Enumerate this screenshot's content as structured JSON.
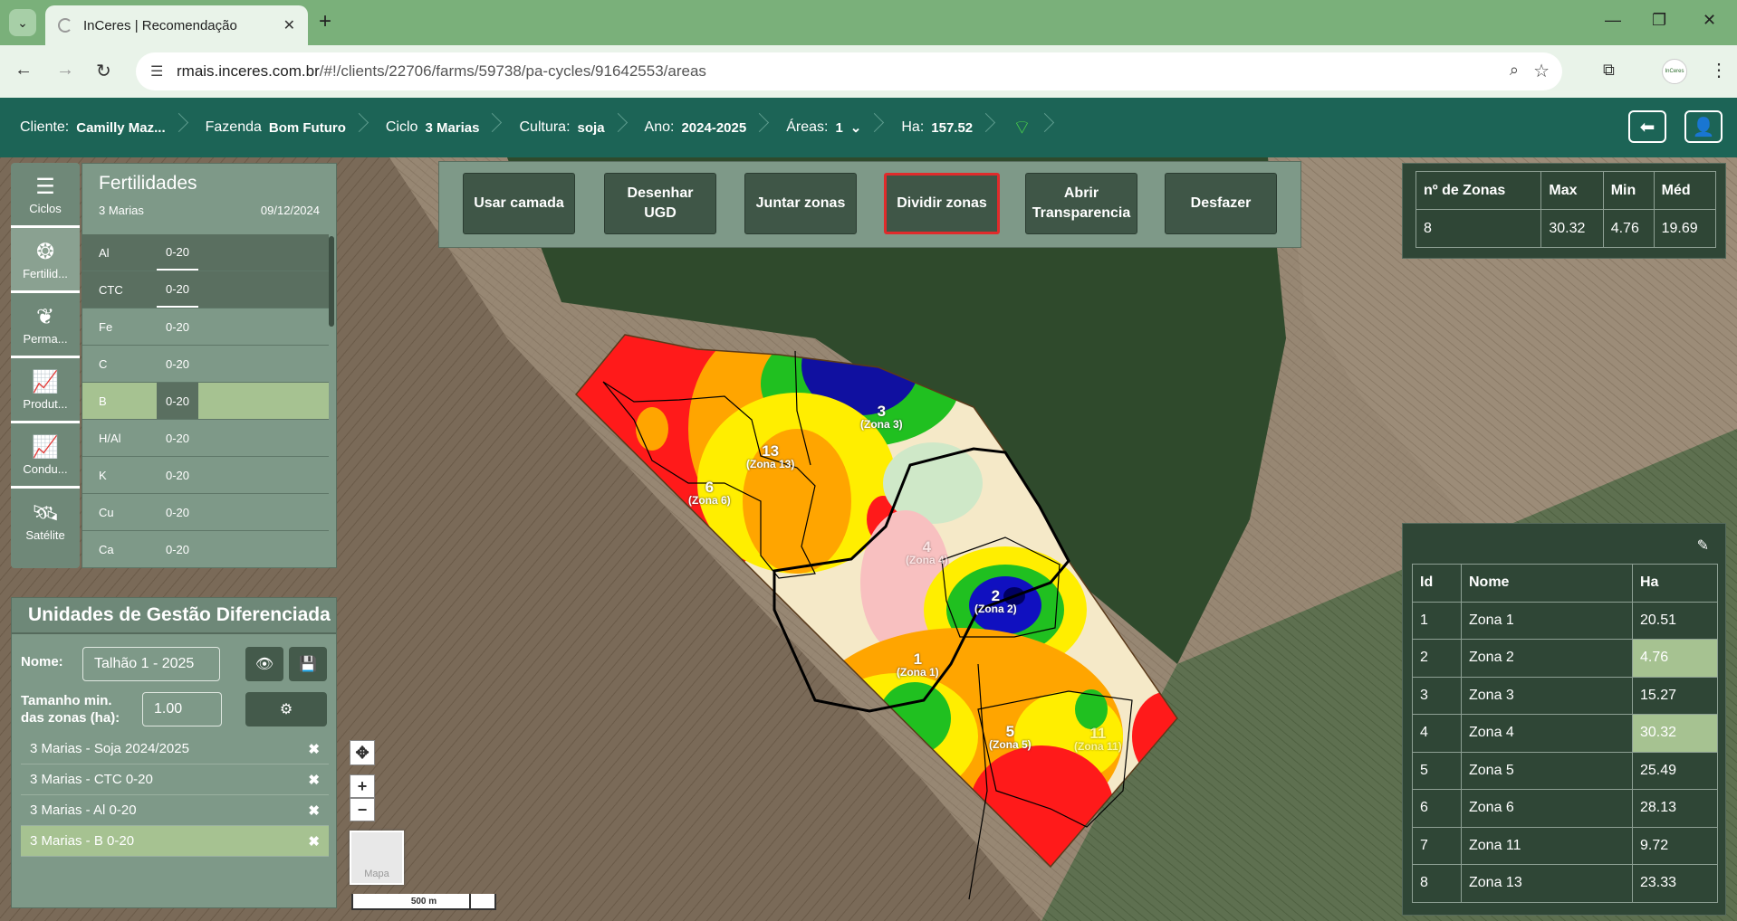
{
  "browser": {
    "tab_title": "InCeres | Recomendação",
    "url_host": "rmais.inceres.com.br",
    "url_path": "/#!/clients/22706/farms/59738/pa-cycles/91642553/areas",
    "profile_label": "InCeres"
  },
  "header": {
    "cliente_label": "Cliente:",
    "cliente_value": "Camilly Maz...",
    "fazenda_label": "Fazenda",
    "fazenda_value": "Bom Futuro",
    "ciclo_label": "Ciclo",
    "ciclo_value": "3 Marias",
    "cultura_label": "Cultura:",
    "cultura_value": "soja",
    "ano_label": "Ano:",
    "ano_value": "2024-2025",
    "areas_label": "Áreas:",
    "areas_value": "1",
    "ha_label": "Ha:",
    "ha_value": "157.52"
  },
  "sidebar": {
    "items": [
      {
        "label": "Ciclos",
        "icon": "list-icon"
      },
      {
        "label": "Fertilid...",
        "icon": "fertility-icon"
      },
      {
        "label": "Perma...",
        "icon": "plants-icon"
      },
      {
        "label": "Produt...",
        "icon": "chart-icon"
      },
      {
        "label": "Condu...",
        "icon": "chart-icon"
      },
      {
        "label": "Satélite",
        "icon": "satellite-icon"
      }
    ]
  },
  "fertilidades": {
    "title": "Fertilidades",
    "subtitle": "3 Marias",
    "date": "09/12/2024",
    "rows": [
      {
        "name": "Al",
        "depth": "0-20"
      },
      {
        "name": "CTC",
        "depth": "0-20"
      },
      {
        "name": "Fe",
        "depth": "0-20"
      },
      {
        "name": "C",
        "depth": "0-20"
      },
      {
        "name": "B",
        "depth": "0-20"
      },
      {
        "name": "H/Al",
        "depth": "0-20"
      },
      {
        "name": "K",
        "depth": "0-20"
      },
      {
        "name": "Cu",
        "depth": "0-20"
      },
      {
        "name": "Ca",
        "depth": "0-20"
      }
    ]
  },
  "ugd": {
    "title": "Unidades de Gestão Diferenciada",
    "nome_label": "Nome:",
    "nome_value": "Talhão 1 - 2025",
    "tamanho_label_1": "Tamanho min.",
    "tamanho_label_2": "das zonas (ha):",
    "tamanho_value": "1.00",
    "layers": [
      {
        "label": "3 Marias - Soja 2024/2025"
      },
      {
        "label": "3 Marias - CTC 0-20"
      },
      {
        "label": "3 Marias - Al 0-20"
      },
      {
        "label": "3 Marias - B 0-20"
      }
    ]
  },
  "toolbar": {
    "usar_camada": "Usar camada",
    "desenhar_1": "Desenhar",
    "desenhar_2": "UGD",
    "juntar": "Juntar zonas",
    "dividir": "Dividir zonas",
    "abrir_1": "Abrir",
    "abrir_2": "Transparencia",
    "desfazer": "Desfazer"
  },
  "stats": {
    "headers": [
      "nº de Zonas",
      "Max",
      "Min",
      "Méd"
    ],
    "values": [
      "8",
      "30.32",
      "4.76",
      "19.69"
    ]
  },
  "zones_table": {
    "headers": [
      "Id",
      "Nome",
      "Ha"
    ],
    "rows": [
      {
        "id": "1",
        "nome": "Zona 1",
        "ha": "20.51"
      },
      {
        "id": "2",
        "nome": "Zona 2",
        "ha": "4.76"
      },
      {
        "id": "3",
        "nome": "Zona 3",
        "ha": "15.27"
      },
      {
        "id": "4",
        "nome": "Zona 4",
        "ha": "30.32"
      },
      {
        "id": "5",
        "nome": "Zona 5",
        "ha": "25.49"
      },
      {
        "id": "6",
        "nome": "Zona 6",
        "ha": "28.13"
      },
      {
        "id": "7",
        "nome": "Zona 11",
        "ha": "9.72"
      },
      {
        "id": "8",
        "nome": "Zona 13",
        "ha": "23.33"
      }
    ]
  },
  "map": {
    "thumb_label": "Mapa",
    "scale_label": "500 m",
    "zone_labels": [
      {
        "num": "6",
        "name": "(Zona 6)"
      },
      {
        "num": "13",
        "name": "(Zona 13)"
      },
      {
        "num": "3",
        "name": "(Zona 3)"
      },
      {
        "num": "4",
        "name": "(Zona 4)"
      },
      {
        "num": "2",
        "name": "(Zona 2)"
      },
      {
        "num": "1",
        "name": "(Zona 1)"
      },
      {
        "num": "5",
        "name": "(Zona 5)"
      },
      {
        "num": "11",
        "name": "(Zona 11)"
      }
    ]
  }
}
